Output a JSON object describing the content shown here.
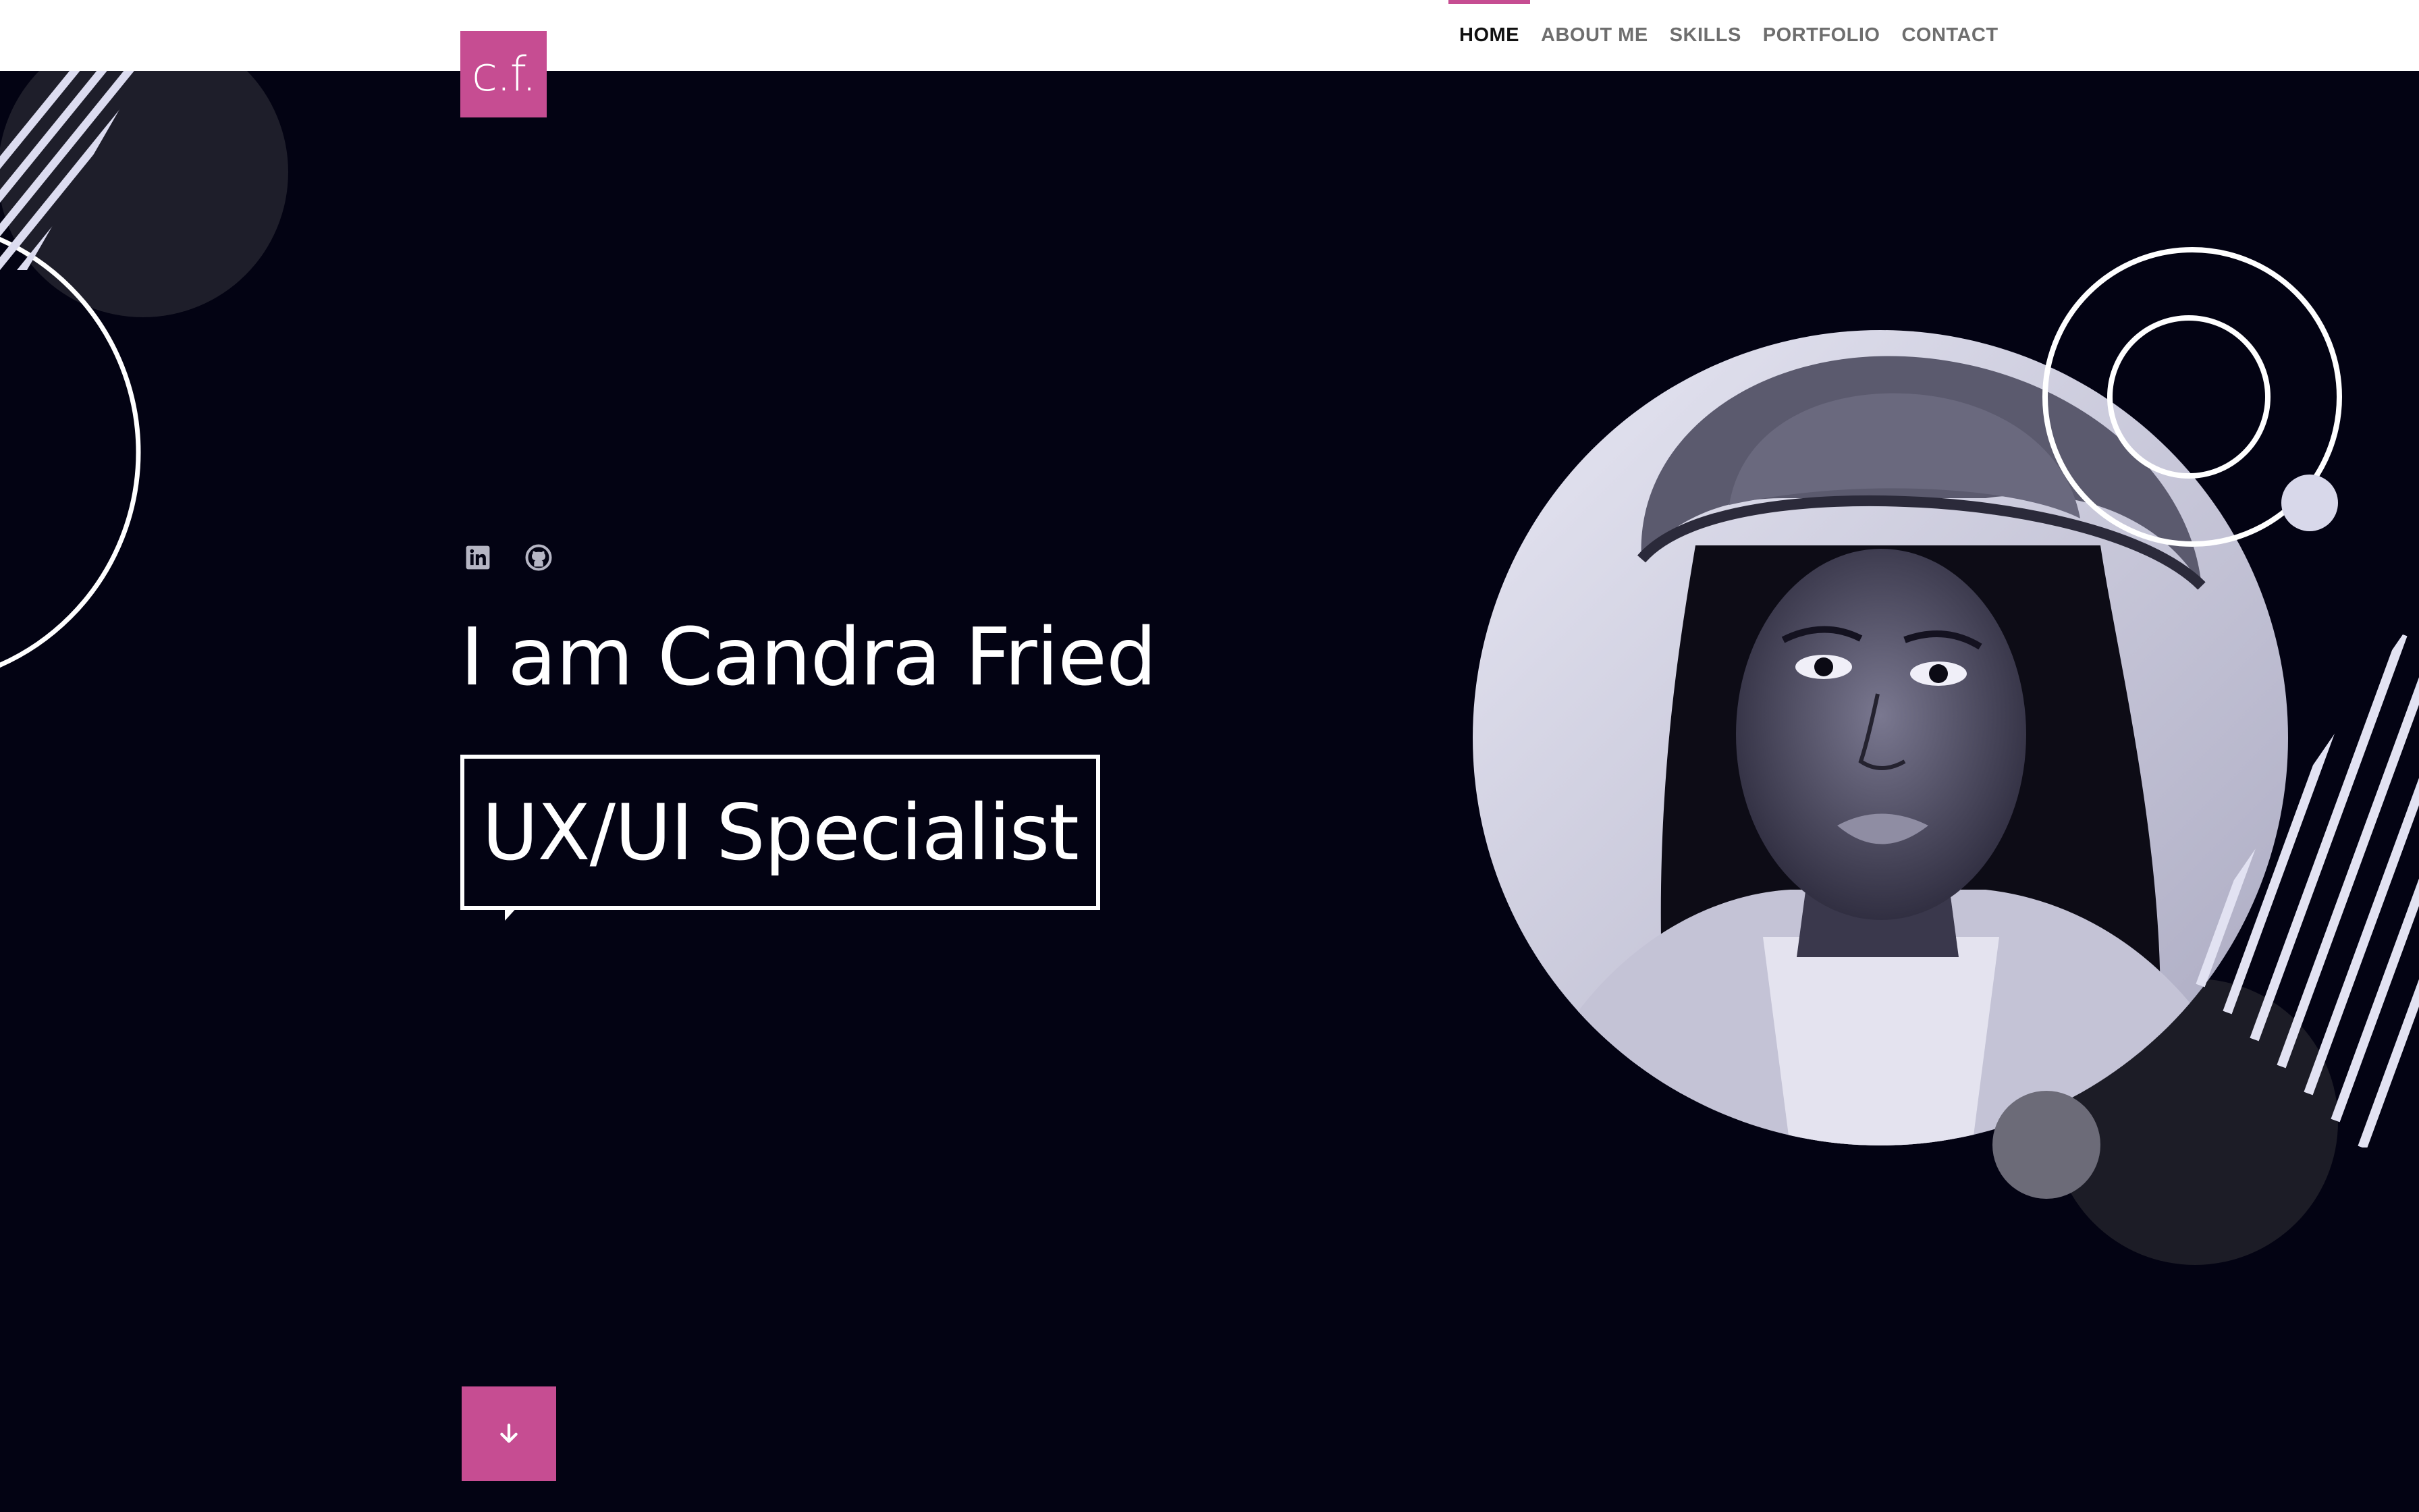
{
  "brand": {
    "logo_text": "c.f.",
    "accent": "#c64d92",
    "background": "#030313"
  },
  "nav": {
    "items": [
      {
        "label": "HOME",
        "active": true
      },
      {
        "label": "ABOUT ME",
        "active": false
      },
      {
        "label": "SKILLS",
        "active": false
      },
      {
        "label": "PORTFOLIO",
        "active": false
      },
      {
        "label": "CONTACT",
        "active": false
      }
    ]
  },
  "social": [
    {
      "icon": "linkedin-icon"
    },
    {
      "icon": "github-icon"
    }
  ],
  "hero": {
    "headline": "I am Candra Fried",
    "role": "UX/UI Specialist",
    "scroll_icon": "arrow-down-icon"
  },
  "portrait": {
    "icon": "portrait-photo"
  }
}
